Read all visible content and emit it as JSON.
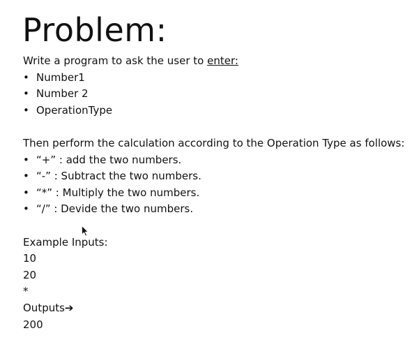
{
  "title": "Problem:",
  "intro": {
    "text": "Write a program to ask the user to ",
    "underlined": "enter:"
  },
  "inputs_list": [
    "Number1",
    "Number 2",
    "OperationType"
  ],
  "calc_intro": "Then perform the calculation according to the Operation Type as follows:",
  "operations": [
    "“+” : add the two numbers.",
    "“-” : Subtract the two numbers.",
    "“*” : Multiply the two numbers.",
    "“/” : Devide the two numbers."
  ],
  "bullet_char": "•",
  "example": {
    "label": "Example Inputs:",
    "values": [
      "10",
      "20",
      "*"
    ],
    "outputs_label": "Outputs",
    "outputs_arrow": "➔",
    "result": "200"
  }
}
